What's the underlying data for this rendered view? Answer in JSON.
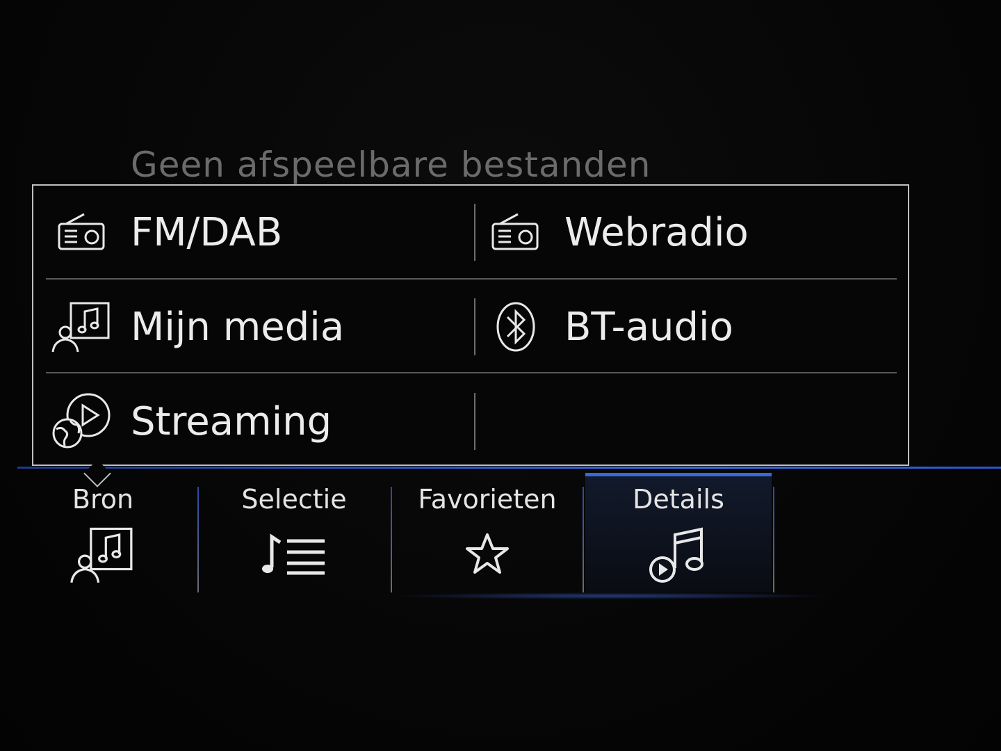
{
  "background": {
    "status_message": "Geen afspeelbare bestanden"
  },
  "source_menu": {
    "items": [
      {
        "label": "FM/DAB",
        "icon": "radio-icon"
      },
      {
        "label": "Webradio",
        "icon": "radio-icon"
      },
      {
        "label": "Mijn media",
        "icon": "my-media-icon"
      },
      {
        "label": "BT-audio",
        "icon": "bluetooth-icon"
      },
      {
        "label": "Streaming",
        "icon": "streaming-icon"
      }
    ]
  },
  "tabs": [
    {
      "label": "Bron",
      "icon": "my-media-icon",
      "active": false
    },
    {
      "label": "Selectie",
      "icon": "playlist-icon",
      "active": false
    },
    {
      "label": "Favorieten",
      "icon": "star-icon",
      "active": false
    },
    {
      "label": "Details",
      "icon": "music-play-icon",
      "active": true
    }
  ],
  "colors": {
    "accent": "#3868e0",
    "text": "#ececec",
    "muted_text": "#6b6b6b",
    "border": "#bfbfbf"
  }
}
